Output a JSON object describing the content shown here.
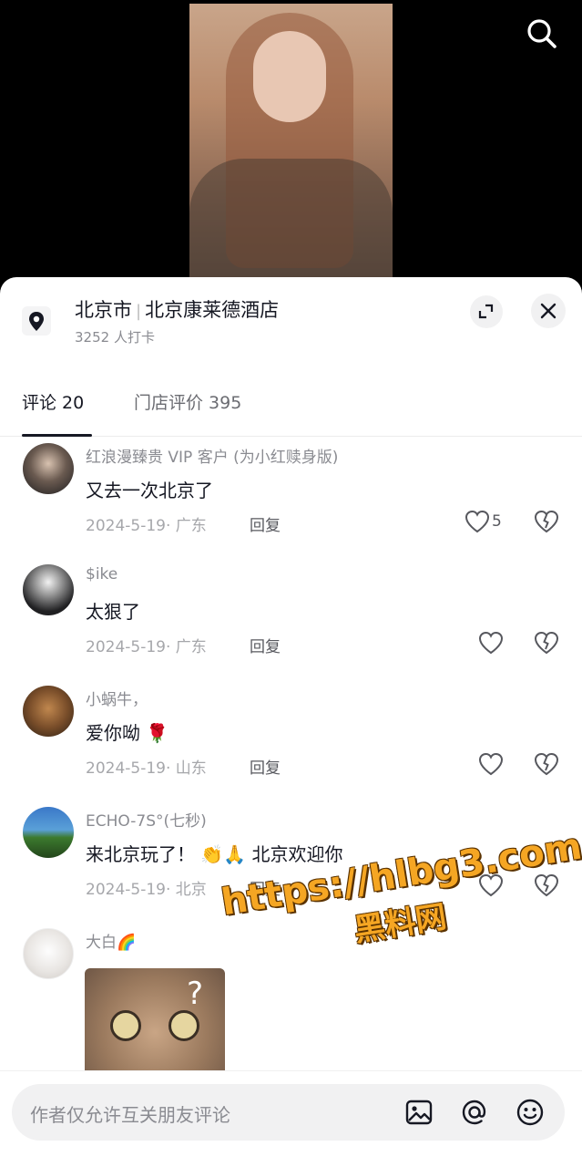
{
  "location": {
    "city": "北京市",
    "place": "北京康莱德酒店",
    "checkins": "3252 人打卡"
  },
  "tabs": [
    {
      "label": "评论 20",
      "active": true
    },
    {
      "label": "门店评价 395",
      "active": false
    }
  ],
  "comments": [
    {
      "user": "红浪漫臻贵 VIP 客户 (为小红赎身版)",
      "text": "又去一次北京了",
      "date": "2024-5-19",
      "region": "广东",
      "reply": "回复",
      "likes": "5"
    },
    {
      "user": "$ike",
      "text": "太狠了",
      "date": "2024-5-19",
      "region": "广东",
      "reply": "回复",
      "likes": ""
    },
    {
      "user": "小蜗牛，",
      "text": "爱你呦 🌹",
      "date": "2024-5-19",
      "region": "山东",
      "reply": "回复",
      "likes": ""
    },
    {
      "user": "ECHO-7S°(七秒)",
      "text": "来北京玩了！ 👏🙏 北京欢迎你",
      "date": "2024-5-19",
      "region": "北京",
      "reply": "回复",
      "likes": ""
    },
    {
      "user": "大白🌈",
      "text": "",
      "date": "",
      "region": "",
      "reply": "",
      "likes": ""
    }
  ],
  "watermark": {
    "url": "https://hlbg3.com",
    "name": "黑料网"
  },
  "input": {
    "placeholder": "作者仅允许互关朋友评论"
  },
  "icons": {
    "search": "search-icon",
    "pin": "location-pin-icon",
    "expand": "expand-icon",
    "close": "close-icon",
    "like": "heart-icon",
    "dislike": "broken-heart-icon",
    "image": "image-icon",
    "mention": "at-icon",
    "emoji": "emoji-icon"
  },
  "colors": {
    "text_primary": "#161823",
    "text_secondary": "#8a8b91",
    "watermark": "#f5a623"
  }
}
